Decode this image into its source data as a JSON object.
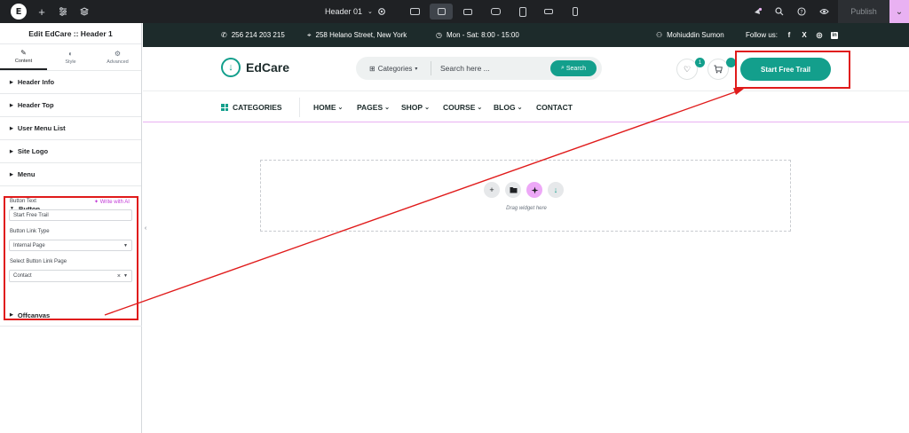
{
  "topbar": {
    "doc_title": "Header 01",
    "publish_label": "Publish"
  },
  "panel": {
    "title": "Edit EdCare :: Header 1",
    "tabs": [
      {
        "label": "Content",
        "icon": "pencil-icon"
      },
      {
        "label": "Style",
        "icon": "half-circle-icon"
      },
      {
        "label": "Advanced",
        "icon": "gear-icon"
      }
    ],
    "sections": [
      "Header Info",
      "Header Top",
      "User Menu List",
      "Site Logo",
      "Menu"
    ],
    "button_section": {
      "title": "Button",
      "button_text_label": "Button Text",
      "write_ai_label": "Write with AI",
      "button_text_value": "Start Free Trail",
      "link_type_label": "Button Link Type",
      "link_type_value": "Internal Page",
      "link_page_label": "Select Button Link Page",
      "link_page_value": "Contact"
    },
    "offcanvas": "Offcanvas"
  },
  "site": {
    "phone": "256 214 203 215",
    "address": "258 Helano Street, New York",
    "hours": "Mon - Sat: 8:00 - 15:00",
    "user": "Mohiuddin Sumon",
    "follow": "Follow us:",
    "social": [
      "f",
      "X",
      "◎",
      "in"
    ],
    "logo_name": "EdCare",
    "search_category": "Categories",
    "search_placeholder": "Search here ...",
    "search_button": "Search",
    "wishlist_count": "1",
    "cta": "Start Free Trail",
    "nav_categories": "CATEGORIES",
    "nav": [
      {
        "label": "HOME"
      },
      {
        "label": "PAGES"
      },
      {
        "label": "SHOP"
      },
      {
        "label": "COURSE"
      },
      {
        "label": "BLOG"
      },
      {
        "label": "CONTACT"
      }
    ],
    "drop_label": "Drag widget here"
  },
  "colors": {
    "accent": "#139f8c",
    "annotation": "#e01b1b",
    "dark": "#1d2b2b"
  }
}
